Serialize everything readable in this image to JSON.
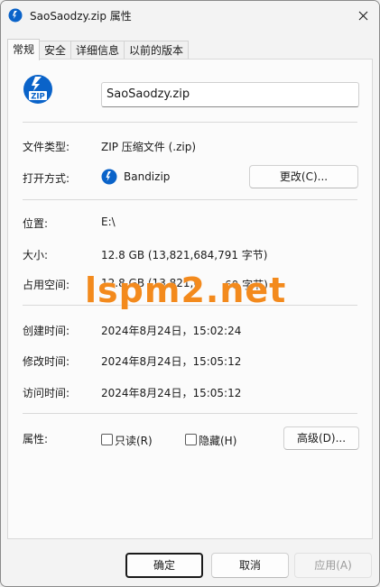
{
  "window": {
    "title": "SaoSaodzy.zip 属性",
    "close_icon": "close-icon"
  },
  "tabs": [
    {
      "label": "常规",
      "active": true
    },
    {
      "label": "安全",
      "active": false
    },
    {
      "label": "详细信息",
      "active": false
    },
    {
      "label": "以前的版本",
      "active": false
    }
  ],
  "general": {
    "file_name": "SaoSaodzy.zip",
    "file_type_label": "文件类型:",
    "file_type_value": "ZIP 压缩文件 (.zip)",
    "open_with_label": "打开方式:",
    "open_with_value": "Bandizip",
    "change_button": "更改(C)...",
    "location_label": "位置:",
    "location_value": "E:\\",
    "size_label": "大小:",
    "size_value": "12.8 GB (13,821,684,791 字节)",
    "size_on_disk_label": "占用空间:",
    "size_on_disk_value": "12.8 GB (13,821,6",
    "size_on_disk_tail": "60 字节)",
    "created_label": "创建时间:",
    "created_value": "2024年8月24日，15:02:24",
    "modified_label": "修改时间:",
    "modified_value": "2024年8月24日，15:05:12",
    "accessed_label": "访问时间:",
    "accessed_value": "2024年8月24日，15:05:12",
    "attributes_label": "属性:",
    "readonly_label": "只读(R)",
    "readonly_checked": false,
    "hidden_label": "隐藏(H)",
    "hidden_checked": false,
    "advanced_button": "高级(D)..."
  },
  "watermark": "lspm2.net",
  "footer": {
    "ok": "确定",
    "cancel": "取消",
    "apply": "应用(A)"
  },
  "colors": {
    "accent": "#0a63c9",
    "watermark": "#f38a1d"
  }
}
